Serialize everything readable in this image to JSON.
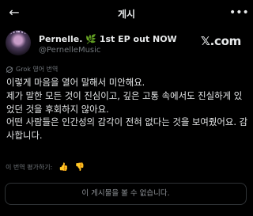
{
  "header": {
    "title": "게시"
  },
  "post": {
    "display_name": "Pernelle.",
    "title_suffix": "1st EP out NOW",
    "title_emoji": "🌿",
    "handle": "@PernelleMusic",
    "source_label": "𝕏.com",
    "translation_label": "Grok 영어 번역",
    "paragraphs": [
      "이렇게 마음을 열어 말해서 미안해요.",
      "제가 말한 모든 것이 진심이고, 깊은 고통 속에서도 진실하게 있었던 것을 후회하지 않아요.",
      "어떤 사람들은 인간성의 감각이 전혀 없다는 것을 보여줬어요. 감사합니다."
    ]
  },
  "rating": {
    "label": "이 번역 평가하기:"
  },
  "unavailable": {
    "text": "이 게시물을 볼 수 없습니다."
  },
  "icons": {
    "back": "back-arrow-icon",
    "more": "more-icon",
    "thumbs_up": "thumbs-up-icon",
    "thumbs_down": "thumbs-down-icon",
    "grok": "grok-icon"
  }
}
